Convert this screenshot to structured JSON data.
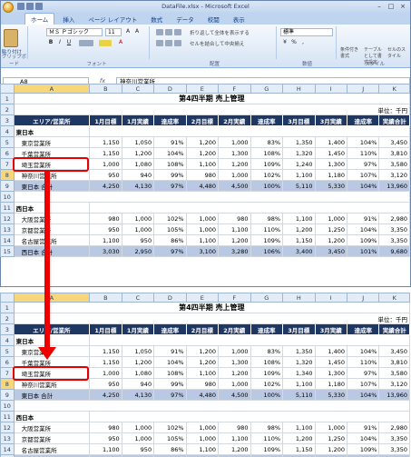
{
  "window": {
    "title": "DataFile.xlsx - Microsoft Excel",
    "tabs": [
      "ホーム",
      "挿入",
      "ページ レイアウト",
      "数式",
      "データ",
      "校閲",
      "表示"
    ]
  },
  "ribbon": {
    "paste_label": "貼り付け",
    "font_name": "ＭＳ Ｐゴシック",
    "font_size": "11",
    "wrap_text": "折り返して全体を表示する",
    "merge_center": "セルを結合して中央揃え",
    "number_format": "標準",
    "cond_format": "条件付き書式",
    "table_format": "テーブルとして書式設定",
    "cell_style": "セルのスタイル",
    "groups": [
      "クリップボード",
      "フォント",
      "配置",
      "数値",
      "スタイル"
    ]
  },
  "formula_bar": {
    "cell_ref": "A8",
    "fx": "fx",
    "content": "神奈川営業所"
  },
  "columns": [
    "A",
    "B",
    "C",
    "D",
    "E",
    "F",
    "G",
    "H",
    "I",
    "J",
    "K"
  ],
  "sheet": {
    "title": "第4四半期 売上管理",
    "unit": "単位：千円",
    "headers": [
      "エリア/営業所",
      "1月目標",
      "1月実績",
      "達成率",
      "2月目標",
      "2月実績",
      "達成率",
      "3月目標",
      "3月実績",
      "達成率",
      "実績合計"
    ],
    "region_east": "東日本",
    "region_west": "西日本",
    "east_before": [
      [
        "東京営業所",
        "1,150",
        "1,050",
        "91%",
        "1,200",
        "1,000",
        "83%",
        "1,350",
        "1,400",
        "104%",
        "3,450"
      ],
      [
        "千葉営業所",
        "1,150",
        "1,200",
        "104%",
        "1,200",
        "1,300",
        "108%",
        "1,320",
        "1,450",
        "110%",
        "3,810"
      ],
      [
        "埼玉営業所",
        "1,000",
        "1,080",
        "108%",
        "1,100",
        "1,200",
        "109%",
        "1,240",
        "1,300",
        "97%",
        "3,580"
      ],
      [
        "神奈川営業所",
        "950",
        "940",
        "99%",
        "980",
        "1,000",
        "102%",
        "1,100",
        "1,180",
        "107%",
        "3,120"
      ]
    ],
    "east_total_before": [
      "東日本 合計",
      "4,250",
      "4,130",
      "97%",
      "4,480",
      "4,500",
      "100%",
      "5,110",
      "5,330",
      "104%",
      "13,960"
    ],
    "east_after": [
      [
        "東京営業所",
        "1,150",
        "1,050",
        "91%",
        "1,200",
        "1,000",
        "83%",
        "1,350",
        "1,400",
        "104%",
        "3,450"
      ],
      [
        "千葉営業所",
        "1,150",
        "1,200",
        "104%",
        "1,200",
        "1,300",
        "108%",
        "1,320",
        "1,450",
        "110%",
        "3,810"
      ],
      [
        "埼玉営業所",
        "1,000",
        "1,080",
        "108%",
        "1,100",
        "1,200",
        "109%",
        "1,340",
        "1,300",
        "97%",
        "3,580"
      ],
      [
        "神奈川営業所",
        "950",
        "940",
        "99%",
        "980",
        "1,000",
        "102%",
        "1,100",
        "1,180",
        "107%",
        "3,120"
      ]
    ],
    "east_total_after": [
      "東日本 合計",
      "4,250",
      "4,130",
      "97%",
      "4,480",
      "4,500",
      "100%",
      "5,110",
      "5,330",
      "104%",
      "13,960"
    ],
    "west": [
      [
        "大阪営業所",
        "980",
        "1,000",
        "102%",
        "1,000",
        "980",
        "98%",
        "1,100",
        "1,000",
        "91%",
        "2,980"
      ],
      [
        "京都営業所",
        "950",
        "1,000",
        "105%",
        "1,000",
        "1,100",
        "110%",
        "1,200",
        "1,250",
        "104%",
        "3,350"
      ],
      [
        "名古屋営業所",
        "1,100",
        "950",
        "86%",
        "1,100",
        "1,200",
        "109%",
        "1,150",
        "1,200",
        "109%",
        "3,350"
      ]
    ],
    "west_total": [
      "西日本 合計",
      "3,030",
      "2,950",
      "97%",
      "3,100",
      "3,280",
      "106%",
      "3,400",
      "3,450",
      "101%",
      "9,680"
    ]
  }
}
